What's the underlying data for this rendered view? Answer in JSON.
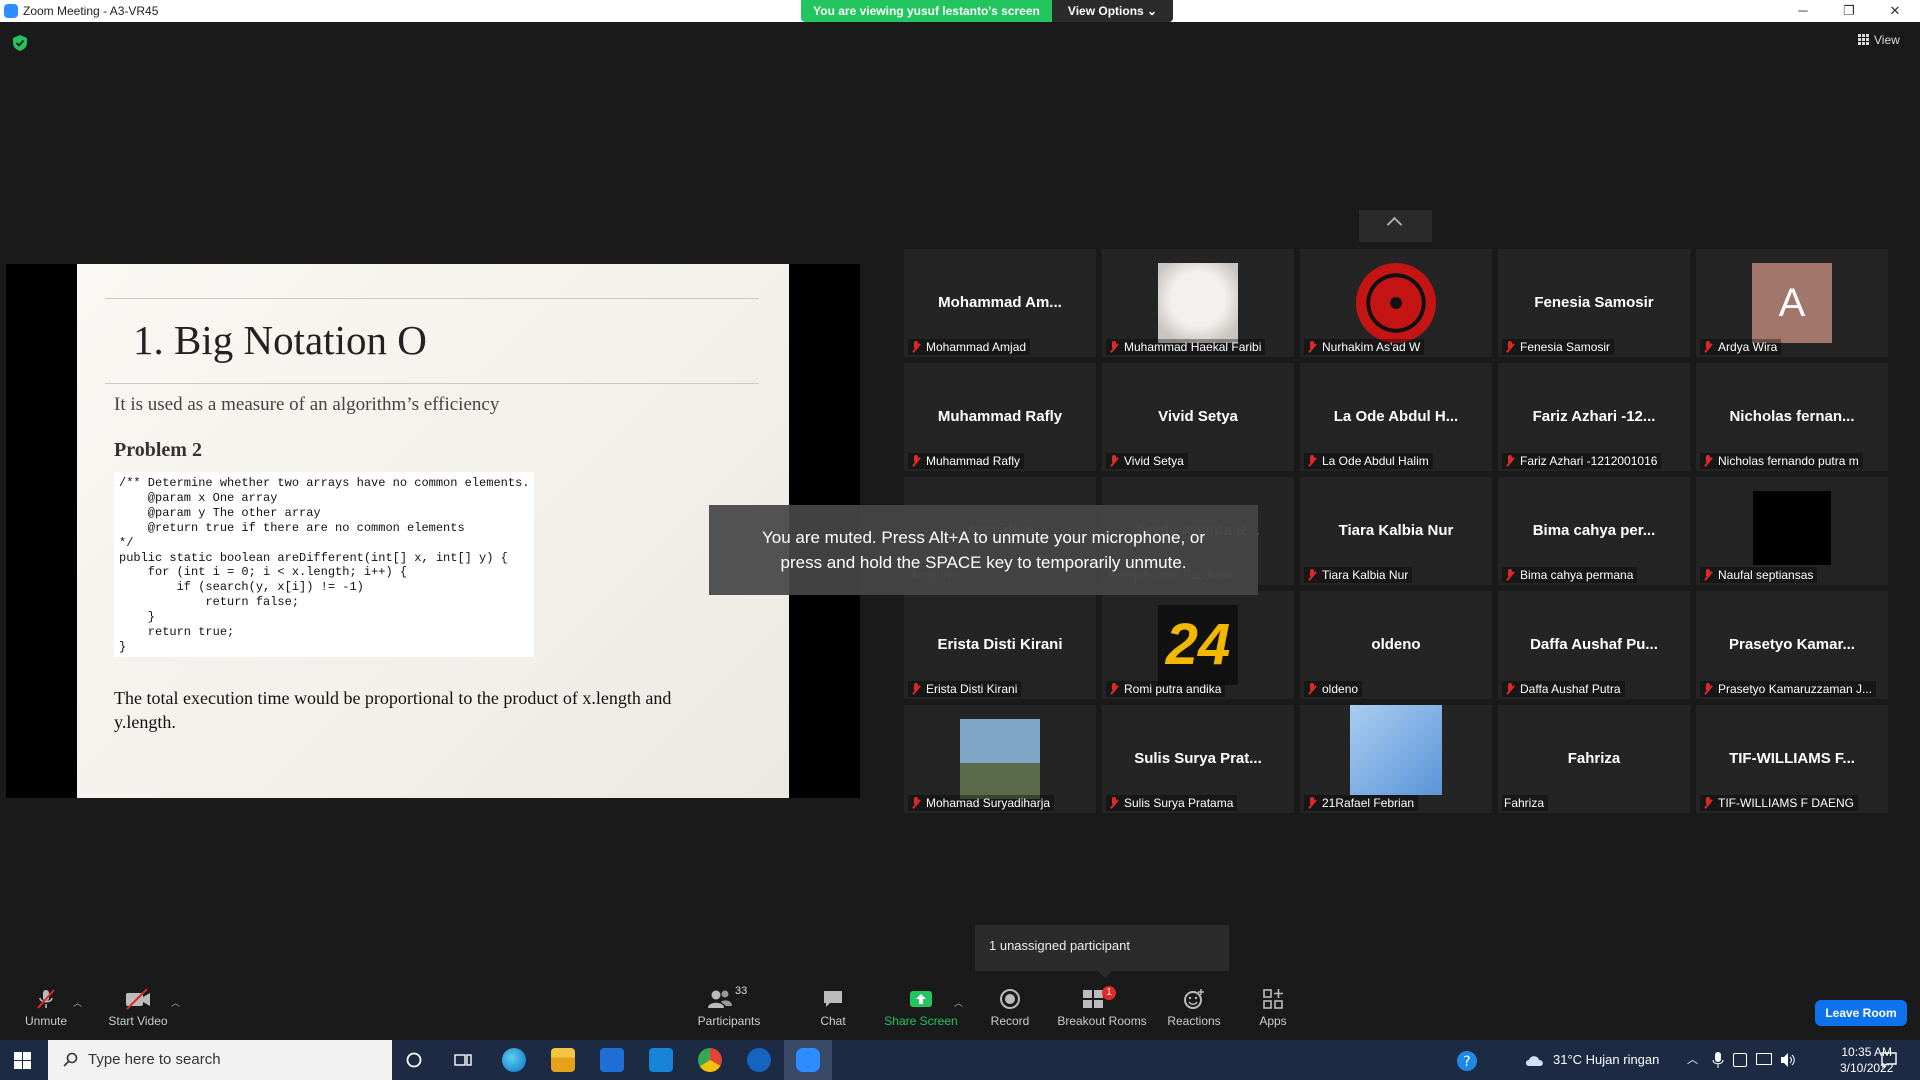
{
  "window": {
    "title": "Zoom Meeting - A3-VR45",
    "minimize": "─",
    "maximize": "❐",
    "close": "✕"
  },
  "banner": {
    "viewing_text": "You are viewing yusuf lestanto's screen",
    "view_options_label": "View Options ⌄"
  },
  "view_label": "View",
  "slide": {
    "title": "1. Big Notation O",
    "subtitle": "It is used as a measure of an algorithm’s efficiency",
    "problem": "Problem 2",
    "code": "/** Determine whether two arrays have no common elements.\n    @param x One array\n    @param y The other array\n    @return true if there are no common elements\n*/\npublic static boolean areDifferent(int[] x, int[] y) {\n    for (int i = 0; i < x.length; i++) {\n        if (search(y, x[i]) != -1)\n            return false;\n    }\n    return true;\n}",
    "footer": "The total execution time would be proportional to the product of x.length and y.length."
  },
  "participants": [
    {
      "display": "Mohammad Am...",
      "label": "Mohammad Amjad",
      "muted": true,
      "avatar": "none"
    },
    {
      "display": "",
      "label": "Muhammad Haekal Faribi",
      "muted": true,
      "avatar": "cat-photo"
    },
    {
      "display": "",
      "label": "Nurhakim As'ad W",
      "muted": true,
      "avatar": "red-sharingan"
    },
    {
      "display": "Fenesia Samosir",
      "label": "Fenesia Samosir",
      "muted": true,
      "avatar": "none"
    },
    {
      "display": "A",
      "label": "Ardya Wira",
      "muted": true,
      "avatar": "letter"
    },
    {
      "display": "Muhammad Rafly",
      "label": "Muhammad Rafly",
      "muted": true,
      "avatar": "none"
    },
    {
      "display": "Vivid Setya",
      "label": "Vivid Setya",
      "muted": true,
      "avatar": "none"
    },
    {
      "display": "La Ode Abdul H...",
      "label": "La Ode Abdul Halim",
      "muted": true,
      "avatar": "none"
    },
    {
      "display": "Fariz Azhari -12...",
      "label": "Fariz Azhari -1212001016",
      "muted": true,
      "avatar": "none"
    },
    {
      "display": "Nicholas  fernan...",
      "label": "Nicholas fernando putra m",
      "muted": true,
      "avatar": "none"
    },
    {
      "display": "Arsyidiva",
      "label": "Arsyidiva",
      "muted": false,
      "avatar": "none"
    },
    {
      "display": "Ferdy Ananta R...",
      "label": "Ferdy Ananta Rusdianto",
      "muted": false,
      "avatar": "none"
    },
    {
      "display": "Tiara Kalbia Nur",
      "label": "Tiara Kalbia Nur",
      "muted": true,
      "avatar": "none"
    },
    {
      "display": "Bima cahya per...",
      "label": "Bima cahya permana",
      "muted": true,
      "avatar": "none"
    },
    {
      "display": "",
      "label": "Naufal septiansas",
      "muted": true,
      "avatar": "black"
    },
    {
      "display": "Erista Disti Kirani",
      "label": "Erista Disti Kirani",
      "muted": true,
      "avatar": "none"
    },
    {
      "display": "24",
      "label": "Romi putra andika",
      "muted": true,
      "avatar": "number-24"
    },
    {
      "display": "oldeno",
      "label": "oldeno",
      "muted": true,
      "avatar": "none"
    },
    {
      "display": "Daffa Aushaf Pu...",
      "label": "Daffa Aushaf Putra",
      "muted": true,
      "avatar": "none"
    },
    {
      "display": "Prasetyo  Kamar...",
      "label": "Prasetyo Kamaruzzaman J...",
      "muted": true,
      "avatar": "none"
    },
    {
      "display": "",
      "label": "Mohamad Suryadiharja",
      "muted": true,
      "avatar": "person-photo"
    },
    {
      "display": "Sulis Surya Prat...",
      "label": "Sulis Surya Pratama",
      "muted": true,
      "avatar": "none"
    },
    {
      "display": "",
      "label": "21Rafael Febrian",
      "muted": true,
      "avatar": "sky-photo"
    },
    {
      "display": "Fahriza",
      "label": "Fahriza",
      "muted": false,
      "avatar": "none"
    },
    {
      "display": "TIF-WILLIAMS F...",
      "label": "TIF-WILLIAMS F DAENG",
      "muted": true,
      "avatar": "none"
    }
  ],
  "toast": {
    "line1": "You are muted. Press Alt+A to unmute your microphone, or",
    "line2": "press and hold the SPACE key to temporarily unmute."
  },
  "unassigned": "1 unassigned participant",
  "toolbar": {
    "unmute": "Unmute",
    "start_video": "Start Video",
    "participants": "Participants",
    "participants_count": "33",
    "chat": "Chat",
    "share_screen": "Share Screen",
    "record": "Record",
    "breakout_rooms": "Breakout Rooms",
    "breakout_badge": "1",
    "reactions": "Reactions",
    "apps": "Apps",
    "leave": "Leave Room"
  },
  "taskbar": {
    "search_placeholder": "Type here to search",
    "weather": "31°C  Hujan ringan",
    "time": "10:35 AM",
    "date": "3/10/2022"
  },
  "colors": {
    "share_banner": "#22c55e",
    "leave_button": "#0e72ed",
    "muted_mic": "#e02828",
    "share_screen_icon": "#22c55e",
    "taskbar": "#1c2a44"
  }
}
